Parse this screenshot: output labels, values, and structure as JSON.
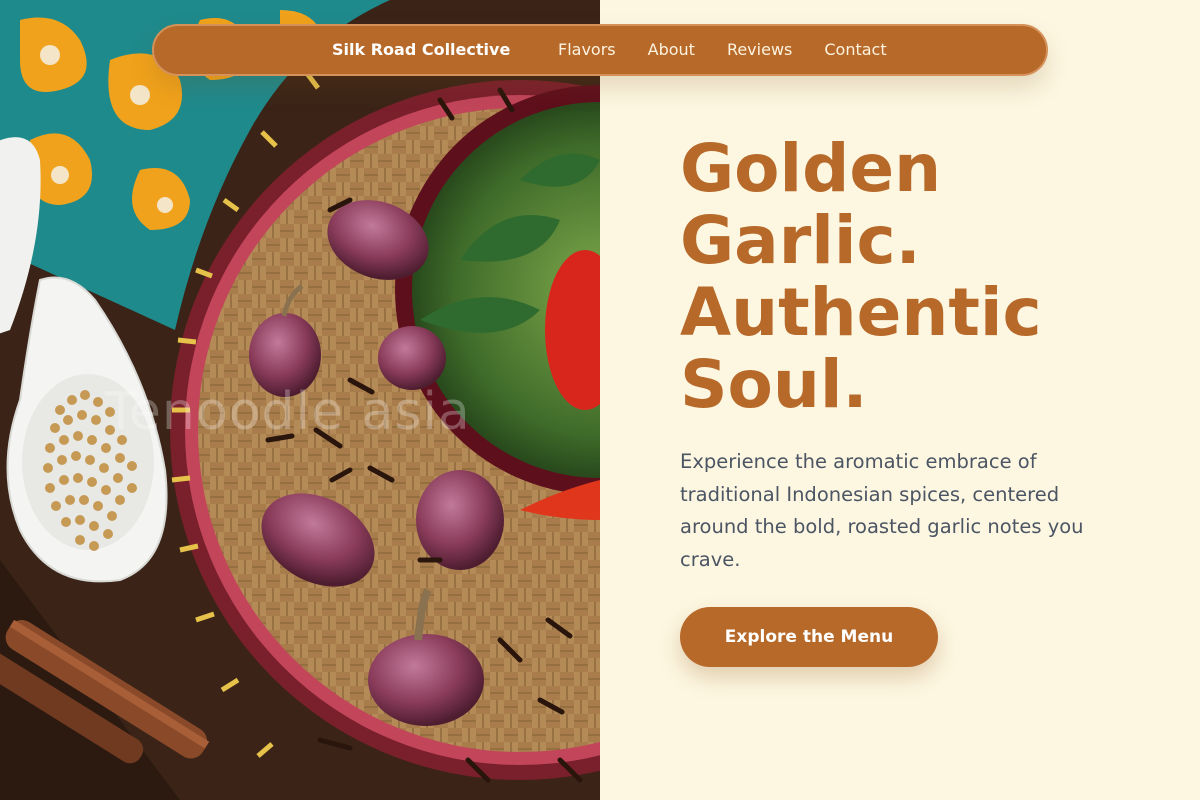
{
  "nav": {
    "brand": "Silk Road Collective",
    "links": [
      "Flavors",
      "About",
      "Reviews",
      "Contact"
    ]
  },
  "hero": {
    "title_lines": [
      "Golden",
      "Garlic.",
      "Authentic",
      "Soul."
    ],
    "description": "Experience the aromatic embrace of traditional Indonesian spices, centered around the bold, roasted garlic notes you crave.",
    "cta_label": "Explore the Menu"
  },
  "photo": {
    "watermark": "Tenoodle asia",
    "subject": "spices-shallots-cloves-basket"
  },
  "colors": {
    "accent": "#b7692a",
    "background": "#fdf7e1",
    "body_text": "#4b5563"
  }
}
